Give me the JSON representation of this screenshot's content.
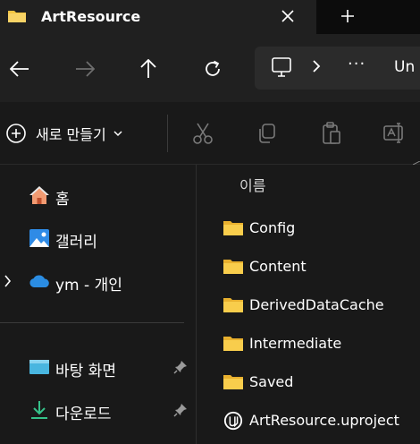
{
  "tab": {
    "title": "ArtResource"
  },
  "address": {
    "more": "···",
    "text": "Un"
  },
  "command_bar": {
    "new_label": "새로 만들기"
  },
  "sidebar": {
    "items": [
      {
        "label": "홈",
        "icon": "home-icon"
      },
      {
        "label": "갤러리",
        "icon": "gallery-icon"
      },
      {
        "label": "ym - 개인",
        "icon": "onedrive-cloud-icon"
      },
      {
        "label": "바탕 화면",
        "icon": "desktop-icon",
        "pinned": true
      },
      {
        "label": "다운로드",
        "icon": "download-icon",
        "pinned": true
      }
    ]
  },
  "file_list": {
    "column_name": "이름",
    "items": [
      {
        "name": "Config",
        "type": "folder"
      },
      {
        "name": "Content",
        "type": "folder"
      },
      {
        "name": "DerivedDataCache",
        "type": "folder"
      },
      {
        "name": "Intermediate",
        "type": "folder"
      },
      {
        "name": "Saved",
        "type": "folder"
      },
      {
        "name": "ArtResource.uproject",
        "type": "uproject"
      }
    ]
  },
  "colors": {
    "folder": "#f4c542",
    "accent": "#4cc2ff",
    "onedrive": "#2b8de3"
  }
}
